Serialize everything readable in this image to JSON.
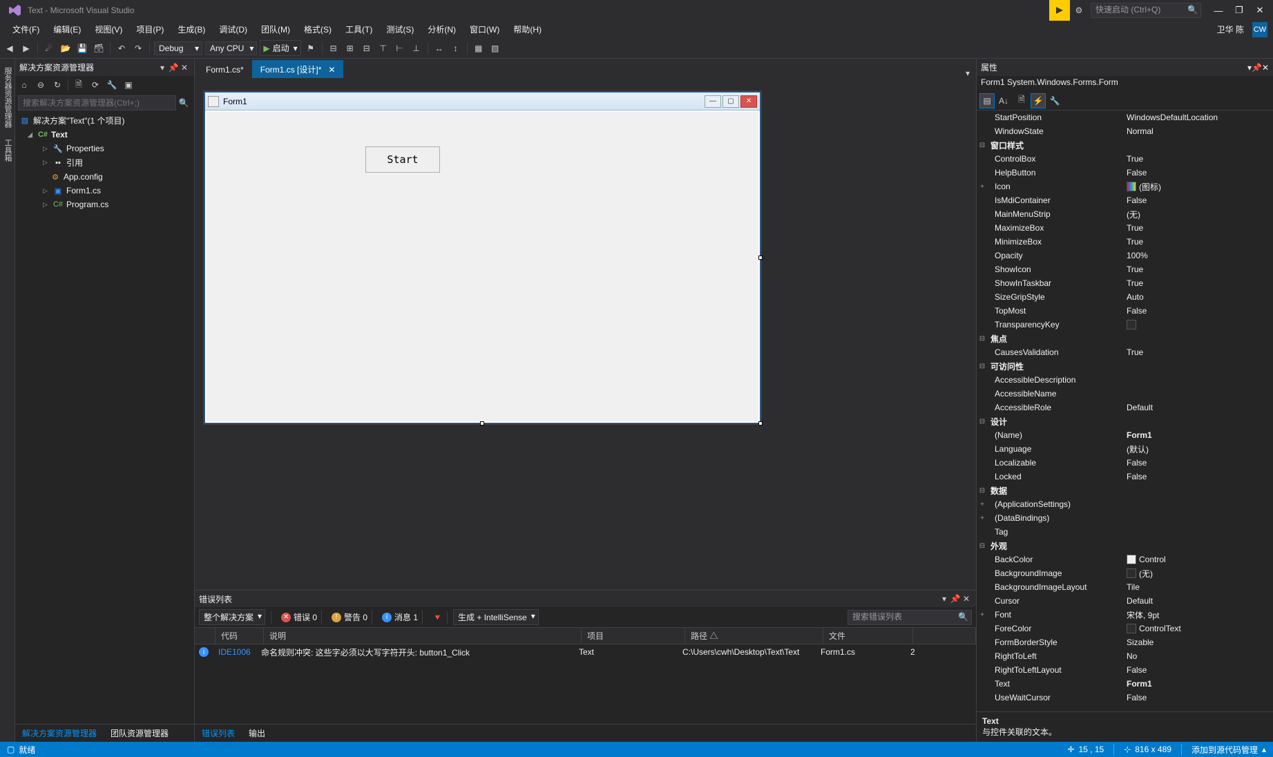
{
  "title": "Text - Microsoft Visual Studio",
  "quick_launch_placeholder": "快速启动 (Ctrl+Q)",
  "menu": {
    "file": "文件(F)",
    "edit": "编辑(E)",
    "view": "视图(V)",
    "project": "项目(P)",
    "build": "生成(B)",
    "debug": "调试(D)",
    "team": "团队(M)",
    "format": "格式(S)",
    "tools": "工具(T)",
    "test": "测试(S)",
    "analyze": "分析(N)",
    "window": "窗口(W)",
    "help": "帮助(H)"
  },
  "user": {
    "name": "卫华 陈",
    "initials": "CW"
  },
  "toolbar": {
    "config": "Debug",
    "platform": "Any CPU",
    "start": "启动"
  },
  "explorer": {
    "title": "解决方案资源管理器",
    "search_placeholder": "搜索解决方案资源管理器(Ctrl+;)",
    "solution": "解决方案\"Text\"(1 个项目)",
    "project": "Text",
    "items": {
      "properties": "Properties",
      "references": "引用",
      "appconfig": "App.config",
      "form1": "Form1.cs",
      "program": "Program.cs"
    },
    "tabs": {
      "solution": "解决方案资源管理器",
      "team": "团队资源管理器"
    }
  },
  "side_tabs": {
    "server": "服务器资源管理器",
    "toolbox": "工具箱"
  },
  "docs": {
    "tab1": "Form1.cs*",
    "tab2": "Form1.cs [设计]*"
  },
  "form": {
    "title": "Form1",
    "button": "Start"
  },
  "errorlist": {
    "title": "错误列表",
    "scope": "整个解决方案",
    "errors": "错误 0",
    "warnings": "警告 0",
    "messages": "消息 1",
    "build": "生成 + IntelliSense",
    "search_placeholder": "搜索错误列表",
    "cols": {
      "code": "代码",
      "desc": "说明",
      "project": "项目",
      "path": "路径 △",
      "file": "文件",
      "line": ""
    },
    "row": {
      "code": "IDE1006",
      "desc": "命名规则冲突: 这些字必须以大写字符开头: button1_Click",
      "project": "Text",
      "path": "C:\\Users\\cwh\\Desktop\\Text\\Text",
      "file": "Form1.cs",
      "line": "2"
    },
    "tabs": {
      "errors": "错误列表",
      "output": "输出"
    }
  },
  "props": {
    "title": "属性",
    "object": "Form1 System.Windows.Forms.Form",
    "footer_name": "Text",
    "footer_desc": "与控件关联的文本。",
    "items": [
      {
        "k": "StartPosition",
        "v": "WindowsDefaultLocation"
      },
      {
        "k": "WindowState",
        "v": "Normal"
      },
      {
        "cat": "窗口样式"
      },
      {
        "k": "ControlBox",
        "v": "True"
      },
      {
        "k": "HelpButton",
        "v": "False"
      },
      {
        "k": "Icon",
        "v": "(图标)",
        "exp": "+",
        "icon": "linear-gradient(90deg,#e06,#0ae,#fc0)"
      },
      {
        "k": "IsMdiContainer",
        "v": "False"
      },
      {
        "k": "MainMenuStrip",
        "v": "(无)"
      },
      {
        "k": "MaximizeBox",
        "v": "True"
      },
      {
        "k": "MinimizeBox",
        "v": "True"
      },
      {
        "k": "Opacity",
        "v": "100%"
      },
      {
        "k": "ShowIcon",
        "v": "True"
      },
      {
        "k": "ShowInTaskbar",
        "v": "True"
      },
      {
        "k": "SizeGripStyle",
        "v": "Auto"
      },
      {
        "k": "TopMost",
        "v": "False"
      },
      {
        "k": "TransparencyKey",
        "v": "",
        "swatch": "#2d2d30"
      },
      {
        "cat": "焦点"
      },
      {
        "k": "CausesValidation",
        "v": "True"
      },
      {
        "cat": "可访问性"
      },
      {
        "k": "AccessibleDescription",
        "v": ""
      },
      {
        "k": "AccessibleName",
        "v": ""
      },
      {
        "k": "AccessibleRole",
        "v": "Default"
      },
      {
        "cat": "设计"
      },
      {
        "k": "(Name)",
        "v": "Form1",
        "bold": true
      },
      {
        "k": "Language",
        "v": "(默认)"
      },
      {
        "k": "Localizable",
        "v": "False"
      },
      {
        "k": "Locked",
        "v": "False"
      },
      {
        "cat": "数据"
      },
      {
        "k": "(ApplicationSettings)",
        "v": "",
        "exp": "+"
      },
      {
        "k": "(DataBindings)",
        "v": "",
        "exp": "+"
      },
      {
        "k": "Tag",
        "v": ""
      },
      {
        "cat": "外观"
      },
      {
        "k": "BackColor",
        "v": "Control",
        "swatch": "#f0f0f0"
      },
      {
        "k": "BackgroundImage",
        "v": "(无)",
        "swatch": "#2d2d30"
      },
      {
        "k": "BackgroundImageLayout",
        "v": "Tile"
      },
      {
        "k": "Cursor",
        "v": "Default"
      },
      {
        "k": "Font",
        "v": "宋体, 9pt",
        "exp": "+"
      },
      {
        "k": "ForeColor",
        "v": "ControlText",
        "swatch": "#2d2d30"
      },
      {
        "k": "FormBorderStyle",
        "v": "Sizable"
      },
      {
        "k": "RightToLeft",
        "v": "No"
      },
      {
        "k": "RightToLeftLayout",
        "v": "False"
      },
      {
        "k": "Text",
        "v": "Form1",
        "bold": true
      },
      {
        "k": "UseWaitCursor",
        "v": "False"
      }
    ]
  },
  "status": {
    "ready": "就绪",
    "cursor": "15 , 15",
    "size": "816 x 489",
    "source": "添加到源代码管理"
  }
}
